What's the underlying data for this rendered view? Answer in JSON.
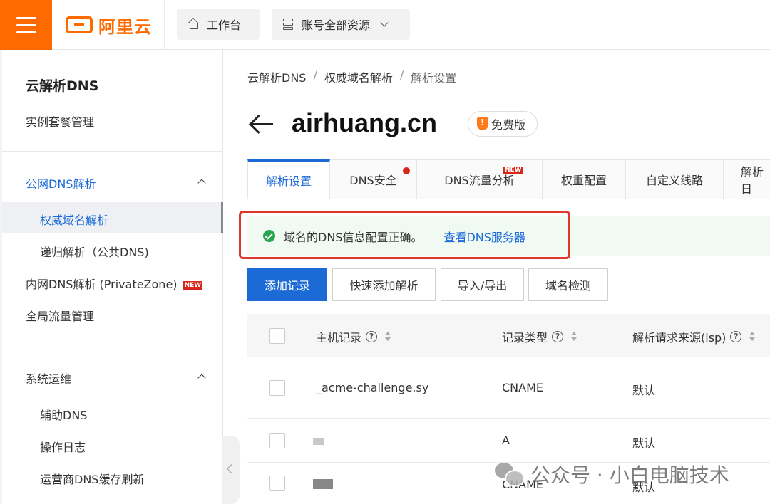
{
  "topbar": {
    "logo_text": "阿里云",
    "workbench_label": "工作台",
    "resources_label": "账号全部资源"
  },
  "sidebar": {
    "title": "云解析DNS",
    "items": [
      {
        "label": "实例套餐管理"
      },
      {
        "label": "公网DNS解析"
      },
      {
        "label": "权威域名解析"
      },
      {
        "label": "递归解析（公共DNS)"
      },
      {
        "label": "内网DNS解析 (PrivateZone)",
        "badge": "NEW"
      },
      {
        "label": "全局流量管理"
      },
      {
        "label": "系统运维"
      },
      {
        "label": "辅助DNS"
      },
      {
        "label": "操作日志"
      },
      {
        "label": "运营商DNS缓存刷新"
      }
    ]
  },
  "breadcrumb": [
    "云解析DNS",
    "权威域名解析",
    "解析设置"
  ],
  "breadcrumb_sep": "/",
  "page": {
    "domain": "airhuang.cn",
    "plan_badge": "免费版"
  },
  "tabs": [
    {
      "label": "解析设置",
      "active": true
    },
    {
      "label": "DNS安全",
      "dot": true
    },
    {
      "label": "DNS流量分析",
      "badge": "NEW"
    },
    {
      "label": "权重配置"
    },
    {
      "label": "自定义线路"
    },
    {
      "label": "解析日"
    }
  ],
  "alert": {
    "message": "域名的DNS信息配置正确。",
    "link": "查看DNS服务器"
  },
  "actions": [
    "添加记录",
    "快速添加解析",
    "导入/导出",
    "域名检测"
  ],
  "table": {
    "columns": [
      "主机记录",
      "记录类型",
      "解析请求来源(isp)"
    ],
    "rows": [
      {
        "host": "_acme-challenge.sy",
        "type": "CNAME",
        "source": "默认"
      },
      {
        "host": "",
        "type": "A",
        "source": "默认"
      },
      {
        "host": "",
        "type": "CNAME",
        "source": "默认"
      }
    ]
  },
  "watermark": "公众号 · 小白电脑技术",
  "colors": {
    "brand": "#ff6a00",
    "primary": "#1c6ad6",
    "success": "#27a550",
    "danger": "#d9261c"
  }
}
